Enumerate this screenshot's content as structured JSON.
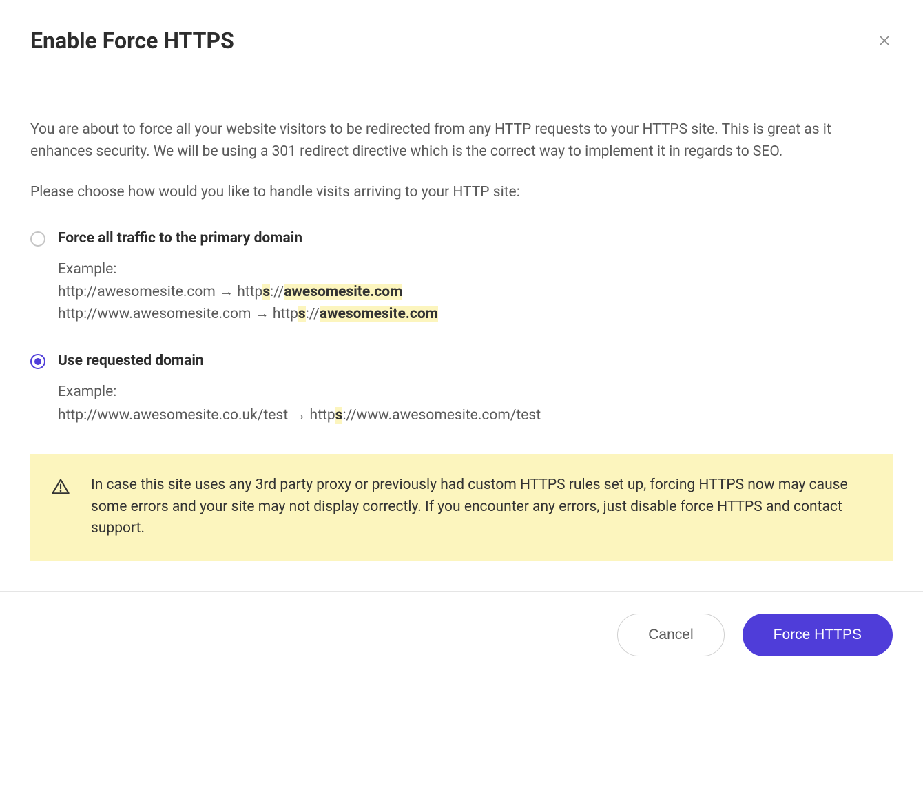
{
  "header": {
    "title": "Enable Force HTTPS"
  },
  "body": {
    "intro": "You are about to force all your website visitors to be redirected from any HTTP requests to your HTTPS site. This is great as it enhances security. We will be using a 301 redirect directive which is the correct way to implement it in regards to SEO.",
    "prompt": "Please choose how would you like to handle visits arriving to your HTTP site:"
  },
  "options": [
    {
      "label": "Force all traffic to the primary domain",
      "selected": false,
      "example_label": "Example:",
      "examples_html": [
        "http://awesomesite.com → http<span class=\"hl-s\">s</span>://<span class=\"hl\">awesomesite.com</span>",
        "http://www.awesomesite.com → http<span class=\"hl-s\">s</span>://<span class=\"hl\">awesomesite.com</span>"
      ]
    },
    {
      "label": "Use requested domain",
      "selected": true,
      "example_label": "Example:",
      "examples_html": [
        "http://www.awesomesite.co.uk/test → http<span class=\"hl-s\">s</span>://www.awesomesite.com/test"
      ]
    }
  ],
  "warning": {
    "text": "In case this site uses any 3rd party proxy or previously had custom HTTPS rules set up, forcing HTTPS now may cause some errors and your site may not display correctly. If you encounter any errors, just disable force HTTPS and contact support."
  },
  "footer": {
    "cancel_label": "Cancel",
    "submit_label": "Force HTTPS"
  }
}
